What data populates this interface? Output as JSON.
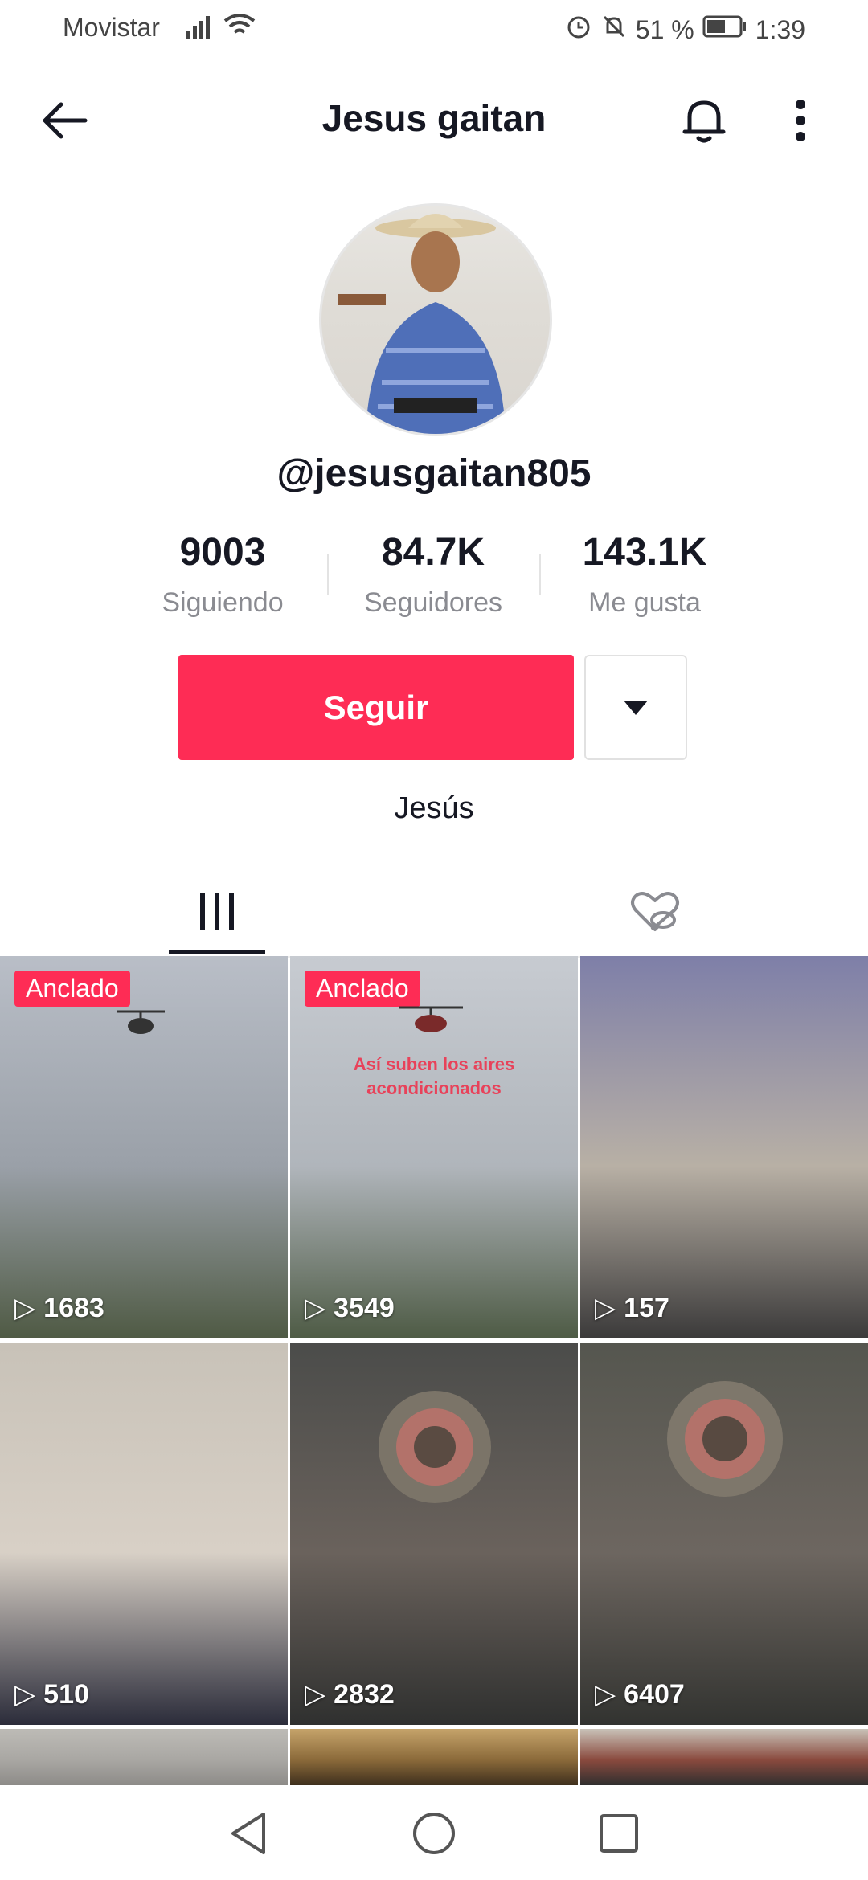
{
  "status_bar": {
    "carrier": "Movistar",
    "battery": "51 %",
    "time": "1:39"
  },
  "header": {
    "title": "Jesus gaitan"
  },
  "profile": {
    "handle": "@jesusgaitan805",
    "stats": [
      {
        "value": "9003",
        "label": "Siguiendo"
      },
      {
        "value": "84.7K",
        "label": "Seguidores"
      },
      {
        "value": "143.1K",
        "label": "Me gusta"
      }
    ],
    "follow_label": "Seguir",
    "bio": "Jesús"
  },
  "videos": [
    {
      "badge": "Anclado",
      "views": "1683",
      "caption": "",
      "colors": [
        "#b9bec7",
        "#9aa0a8",
        "#4f5a44"
      ]
    },
    {
      "badge": "Anclado",
      "views": "3549",
      "caption": "Así suben los aires acondicionados",
      "colors": [
        "#c7cbd1",
        "#b0b5bb",
        "#4e5b45"
      ]
    },
    {
      "badge": "",
      "views": "157",
      "caption": "",
      "colors": [
        "#7e7fa8",
        "#b8b0a5",
        "#3b3a3a"
      ]
    },
    {
      "badge": "",
      "views": "510",
      "caption": "",
      "colors": [
        "#c8c2b8",
        "#d8d0c6",
        "#2b2c3a"
      ]
    },
    {
      "badge": "",
      "views": "2832",
      "caption": "",
      "colors": [
        "#4b4c4a",
        "#6a625c",
        "#2f302f"
      ]
    },
    {
      "badge": "",
      "views": "6407",
      "caption": "",
      "colors": [
        "#55564f",
        "#6d6660",
        "#323330"
      ]
    },
    {
      "badge": "",
      "views": "",
      "caption": "",
      "colors": [
        "#bdbbb6",
        "#a9a7a3",
        "#8d8b88"
      ]
    },
    {
      "badge": "",
      "views": "",
      "caption": "",
      "colors": [
        "#c5a36a",
        "#8b6a3a",
        "#3e2f1d"
      ]
    },
    {
      "badge": "",
      "views": "",
      "caption": "",
      "colors": [
        "#c9c2b8",
        "#8a4a3e",
        "#2f2f2f"
      ]
    }
  ]
}
